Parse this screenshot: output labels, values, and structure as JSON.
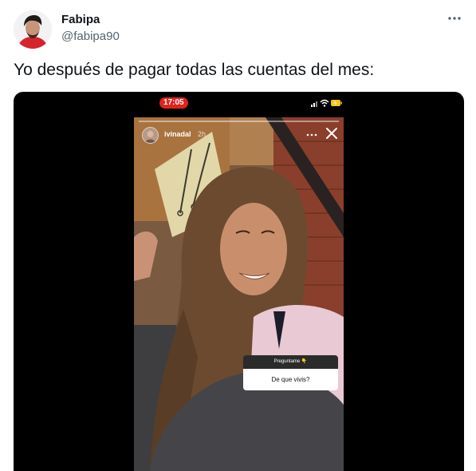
{
  "tweet": {
    "author": {
      "display_name": "Fabipa",
      "handle": "@fabipa90",
      "avatar_icon": "user-avatar"
    },
    "more_icon": "more-horizontal-icon",
    "text": "Yo después de pagar todas las cuentas del mes:"
  },
  "media": {
    "phone_status": {
      "time": "17:05",
      "time_badge_color": "#e0241b",
      "icons": [
        "signal-icon",
        "wifi-icon",
        "battery-charging-icon"
      ]
    },
    "story": {
      "username": "ivinadal",
      "timestamp": "2h",
      "menu_icon": "more-horizontal-icon",
      "close_icon": "close-icon",
      "question_sticker": {
        "header": "Preguntame 👇",
        "question": "De que vivis?"
      }
    }
  }
}
